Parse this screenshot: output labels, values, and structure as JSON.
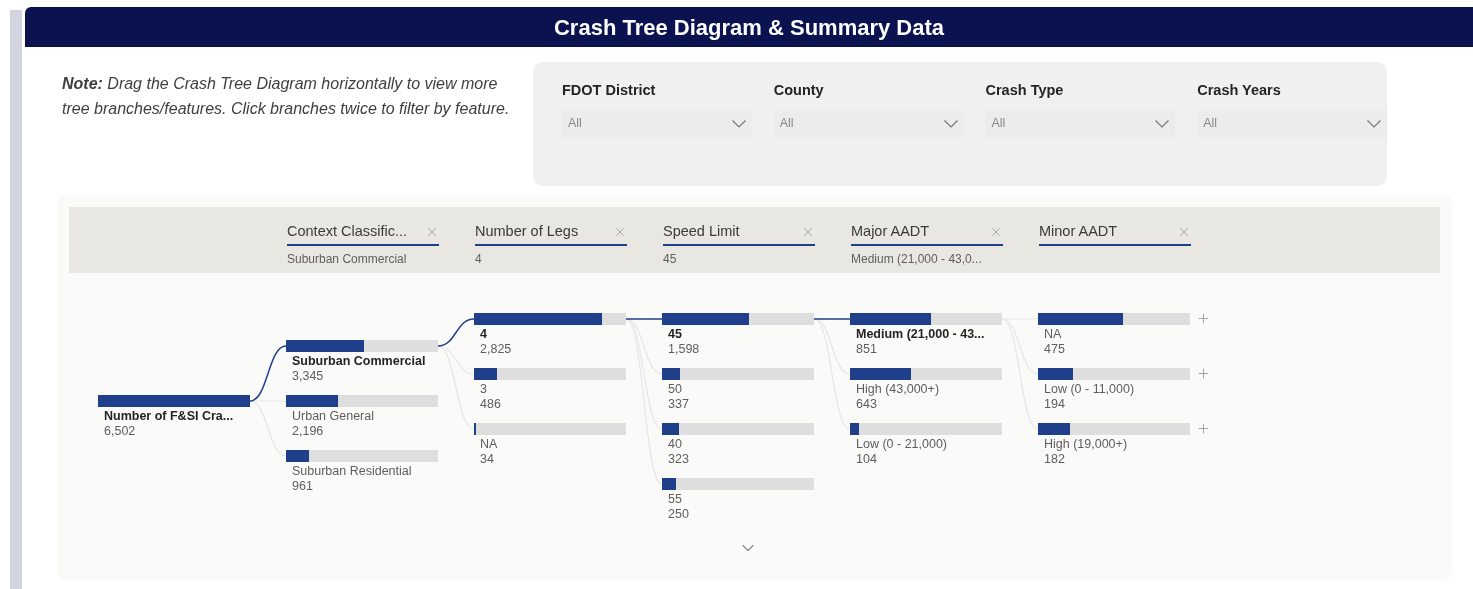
{
  "title": "Crash Tree Diagram & Summary Data",
  "note": "**Note:** Drag the Crash Tree Diagram horizontally to view more tree branches/features. Click branches twice to filter by feature.",
  "filters": [
    {
      "label": "FDOT District",
      "value": "All"
    },
    {
      "label": "County",
      "value": "All"
    },
    {
      "label": "Crash Type",
      "value": "All"
    },
    {
      "label": "Crash Years",
      "value": "All"
    }
  ],
  "tree": {
    "root": {
      "label": "Number of F&SI Cra...",
      "value": "6,502",
      "level": 1
    },
    "levels": [
      {
        "header": "Context Classific...",
        "filter": "Suburban Commercial",
        "nodes": [
          {
            "label": "Suburban Commercial",
            "value": "3,345",
            "level": 0.51,
            "selected": true
          },
          {
            "label": "Urban General",
            "value": "2,196",
            "level": 0.34,
            "selected": false
          },
          {
            "label": "Suburban Residential",
            "value": "961",
            "level": 0.15,
            "selected": false
          }
        ]
      },
      {
        "header": "Number of Legs",
        "filter": "4",
        "nodes": [
          {
            "label": "4",
            "value": "2,825",
            "level": 0.84,
            "selected": true
          },
          {
            "label": "3",
            "value": "486",
            "level": 0.15,
            "selected": false
          },
          {
            "label": "NA",
            "value": "34",
            "level": 0.01,
            "selected": false
          }
        ]
      },
      {
        "header": "Speed Limit",
        "filter": "45",
        "nodes": [
          {
            "label": "45",
            "value": "1,598",
            "level": 0.57,
            "selected": true
          },
          {
            "label": "50",
            "value": "337",
            "level": 0.12,
            "selected": false
          },
          {
            "label": "40",
            "value": "323",
            "level": 0.11,
            "selected": false
          },
          {
            "label": "55",
            "value": "250",
            "level": 0.09,
            "selected": false
          }
        ]
      },
      {
        "header": "Major AADT",
        "filter": "Medium (21,000 - 43,0...",
        "nodes": [
          {
            "label": "Medium (21,000 - 43...",
            "value": "851",
            "level": 0.53,
            "selected": true
          },
          {
            "label": "High (43,000+)",
            "value": "643",
            "level": 0.4,
            "selected": false
          },
          {
            "label": "Low (0 - 21,000)",
            "value": "104",
            "level": 0.06,
            "selected": false
          }
        ]
      },
      {
        "header": "Minor AADT",
        "nodes": [
          {
            "label": "NA",
            "value": "475",
            "level": 0.56,
            "selected": false
          },
          {
            "label": "Low (0 - 11,000)",
            "value": "194",
            "level": 0.23,
            "selected": false
          },
          {
            "label": "High (19,000+)",
            "value": "182",
            "level": 0.21,
            "selected": false
          }
        ]
      }
    ]
  }
}
